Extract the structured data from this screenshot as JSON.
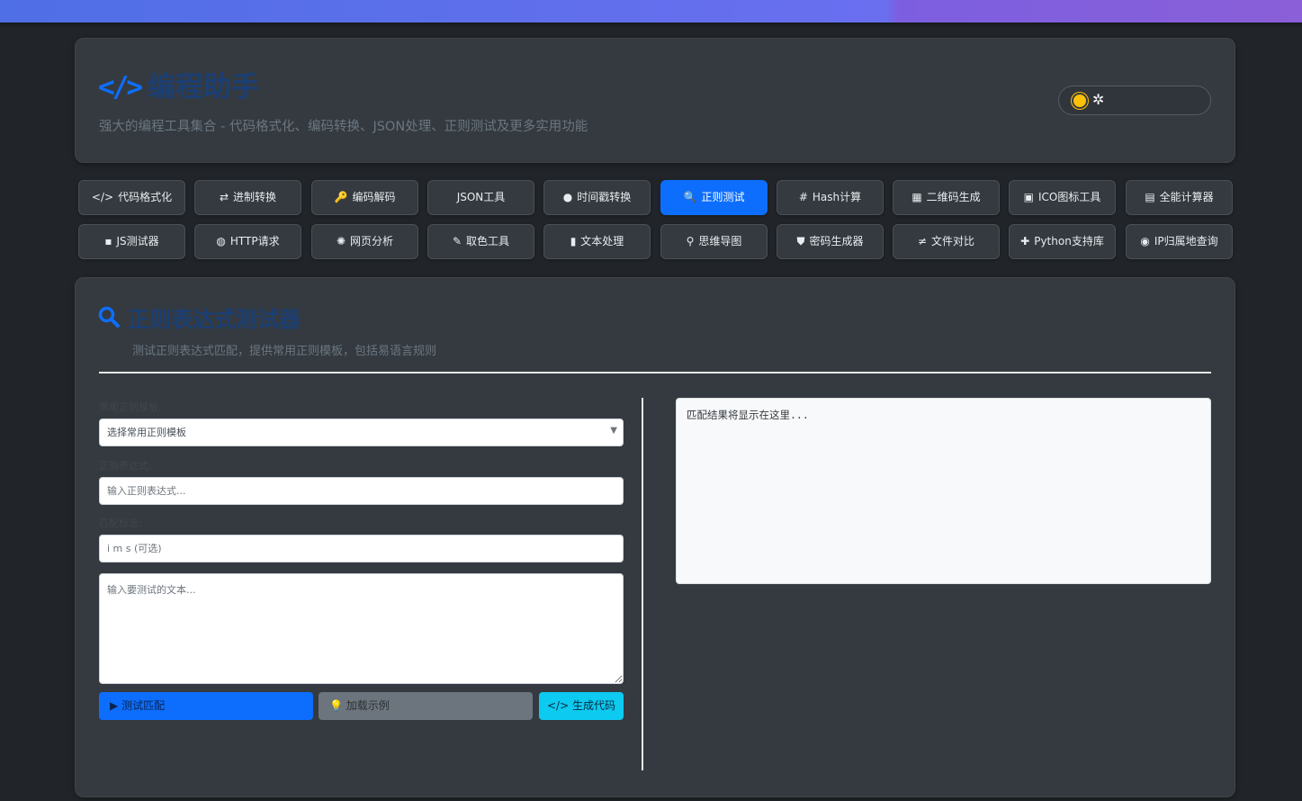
{
  "app": {
    "title": "编程助手",
    "subtitle": "强大的编程工具集合 - 代码格式化、编码转换、JSON处理、正则测试及更多实用功能",
    "logo_icon": "code-icon"
  },
  "theme_toggle": {
    "icons": [
      "sun-icon",
      "gear-icon"
    ]
  },
  "nav": {
    "row1": [
      {
        "label": "代码格式化",
        "icon": "</>",
        "active": false
      },
      {
        "label": "进制转换",
        "icon": "⇄",
        "active": false
      },
      {
        "label": "编码解码",
        "icon": "🔑",
        "active": false
      },
      {
        "label": "JSON工具",
        "icon": "",
        "active": false
      },
      {
        "label": "时间戳转换",
        "icon": "●",
        "active": false
      },
      {
        "label": "正则测试",
        "icon": "🔍",
        "active": true
      },
      {
        "label": "Hash计算",
        "icon": "#",
        "active": false
      },
      {
        "label": "二维码生成",
        "icon": "▦",
        "active": false
      },
      {
        "label": "ICO图标工具",
        "icon": "▣",
        "active": false
      },
      {
        "label": "全能计算器",
        "icon": "▤",
        "active": false
      }
    ],
    "row2": [
      {
        "label": "JS测试器",
        "icon": "▪",
        "active": false
      },
      {
        "label": "HTTP请求",
        "icon": "◍",
        "active": false
      },
      {
        "label": "网页分析",
        "icon": "✺",
        "active": false
      },
      {
        "label": "取色工具",
        "icon": "✎",
        "active": false
      },
      {
        "label": "文本处理",
        "icon": "▮",
        "active": false
      },
      {
        "label": "思维导图",
        "icon": "⚲",
        "active": false
      },
      {
        "label": "密码生成器",
        "icon": "⛊",
        "active": false
      },
      {
        "label": "文件对比",
        "icon": "≠",
        "active": false
      },
      {
        "label": "Python支持库",
        "icon": "✚",
        "active": false
      },
      {
        "label": "IP归属地查询",
        "icon": "◉",
        "active": false
      }
    ]
  },
  "regex": {
    "title": "正则表达式测试器",
    "description": "测试正则表达式匹配，提供常用正则模板，包括易语言规则",
    "template_label": "常用正则模板:",
    "template_value": "选择常用正则模板",
    "pattern_label": "正则表达式:",
    "pattern_placeholder": "输入正则表达式...",
    "flags_label": "匹配标志:",
    "flags_placeholder": "i m s (可选)",
    "text_placeholder": "输入要测试的文本...",
    "buttons": {
      "test": "测试匹配",
      "example": "加载示例",
      "code": "生成代码"
    },
    "result_placeholder": "匹配结果将显示在这里..."
  },
  "colors": {
    "primary": "#0d6efd",
    "secondary": "#6c757d",
    "info": "#0dcaf0",
    "card": "#343a40",
    "background": "#212529",
    "warning": "#ffc107"
  }
}
